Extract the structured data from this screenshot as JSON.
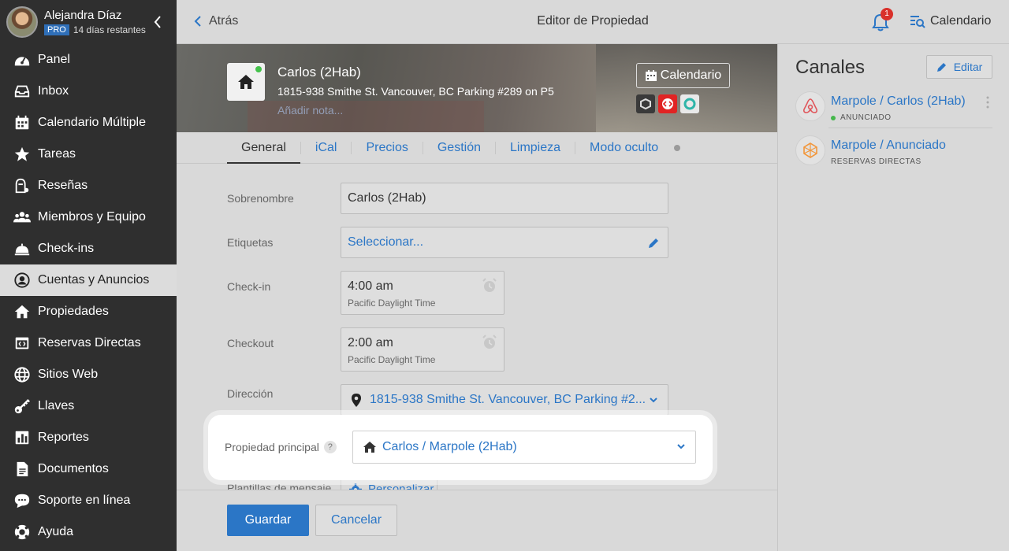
{
  "user": {
    "name": "Alejandra Díaz",
    "plan": "PRO",
    "trial": "14 días restantes"
  },
  "nav": [
    {
      "label": "Panel",
      "icon": "dashboard-icon"
    },
    {
      "label": "Inbox",
      "icon": "inbox-icon"
    },
    {
      "label": "Calendario Múltiple",
      "icon": "calendar-icon"
    },
    {
      "label": "Tareas",
      "icon": "star-icon"
    },
    {
      "label": "Reseñas",
      "icon": "reviews-icon"
    },
    {
      "label": "Miembros y Equipo",
      "icon": "team-icon"
    },
    {
      "label": "Check-ins",
      "icon": "bell-service-icon"
    },
    {
      "label": "Cuentas y Anuncios",
      "icon": "user-circle-icon",
      "active": true
    },
    {
      "label": "Propiedades",
      "icon": "home-icon"
    },
    {
      "label": "Reservas Directas",
      "icon": "code-window-icon"
    },
    {
      "label": "Sitios Web",
      "icon": "globe-icon"
    },
    {
      "label": "Llaves",
      "icon": "key-icon"
    },
    {
      "label": "Reportes",
      "icon": "chart-icon"
    },
    {
      "label": "Documentos",
      "icon": "document-icon"
    },
    {
      "label": "Soporte en línea",
      "icon": "chat-icon"
    },
    {
      "label": "Ayuda",
      "icon": "lifebuoy-icon"
    }
  ],
  "topbar": {
    "back": "Atrás",
    "title": "Editor de Propiedad",
    "notifications": "1",
    "calendar": "Calendario"
  },
  "property": {
    "name": "Carlos (2Hab)",
    "address": "1815-938 Smithe St. Vancouver, BC Parking #289 on P5",
    "add_note": "Añadir nota...",
    "calendar_button": "Calendario"
  },
  "tabs": [
    "General",
    "iCal",
    "Precios",
    "Gestión",
    "Limpieza",
    "Modo oculto"
  ],
  "form": {
    "nickname_label": "Sobrenombre",
    "nickname_value": "Carlos (2Hab)",
    "tags_label": "Etiquetas",
    "tags_value": "Seleccionar...",
    "checkin_label": "Check-in",
    "checkin_time": "4:00 am",
    "checkin_tz": "Pacific Daylight Time",
    "checkout_label": "Checkout",
    "checkout_time": "2:00 am",
    "checkout_tz": "Pacific Daylight Time",
    "address_label": "Dirección",
    "address_value": "1815-938 Smithe St. Vancouver, BC Parking #2...",
    "parent_label": "Propiedad principal",
    "parent_help": "?",
    "parent_value": "Carlos / Marpole (2Hab)",
    "templates_label": "Plantillas de mensaje",
    "templates_button": "Personalizar"
  },
  "footer": {
    "save": "Guardar",
    "cancel": "Cancelar"
  },
  "channels": {
    "title": "Canales",
    "edit": "Editar",
    "items": [
      {
        "account": "Marpole",
        "listing": "/ Carlos (2Hab)",
        "status": "ANUNCIADO"
      },
      {
        "account": "Marpole",
        "listing": "/ Anunciado",
        "status": "RESERVAS DIRECTAS"
      }
    ]
  },
  "colors": {
    "accent": "#2b76c6",
    "sidebar": "#2f2f2f",
    "badge": "#d9312b",
    "status_ok": "#45b74b"
  }
}
